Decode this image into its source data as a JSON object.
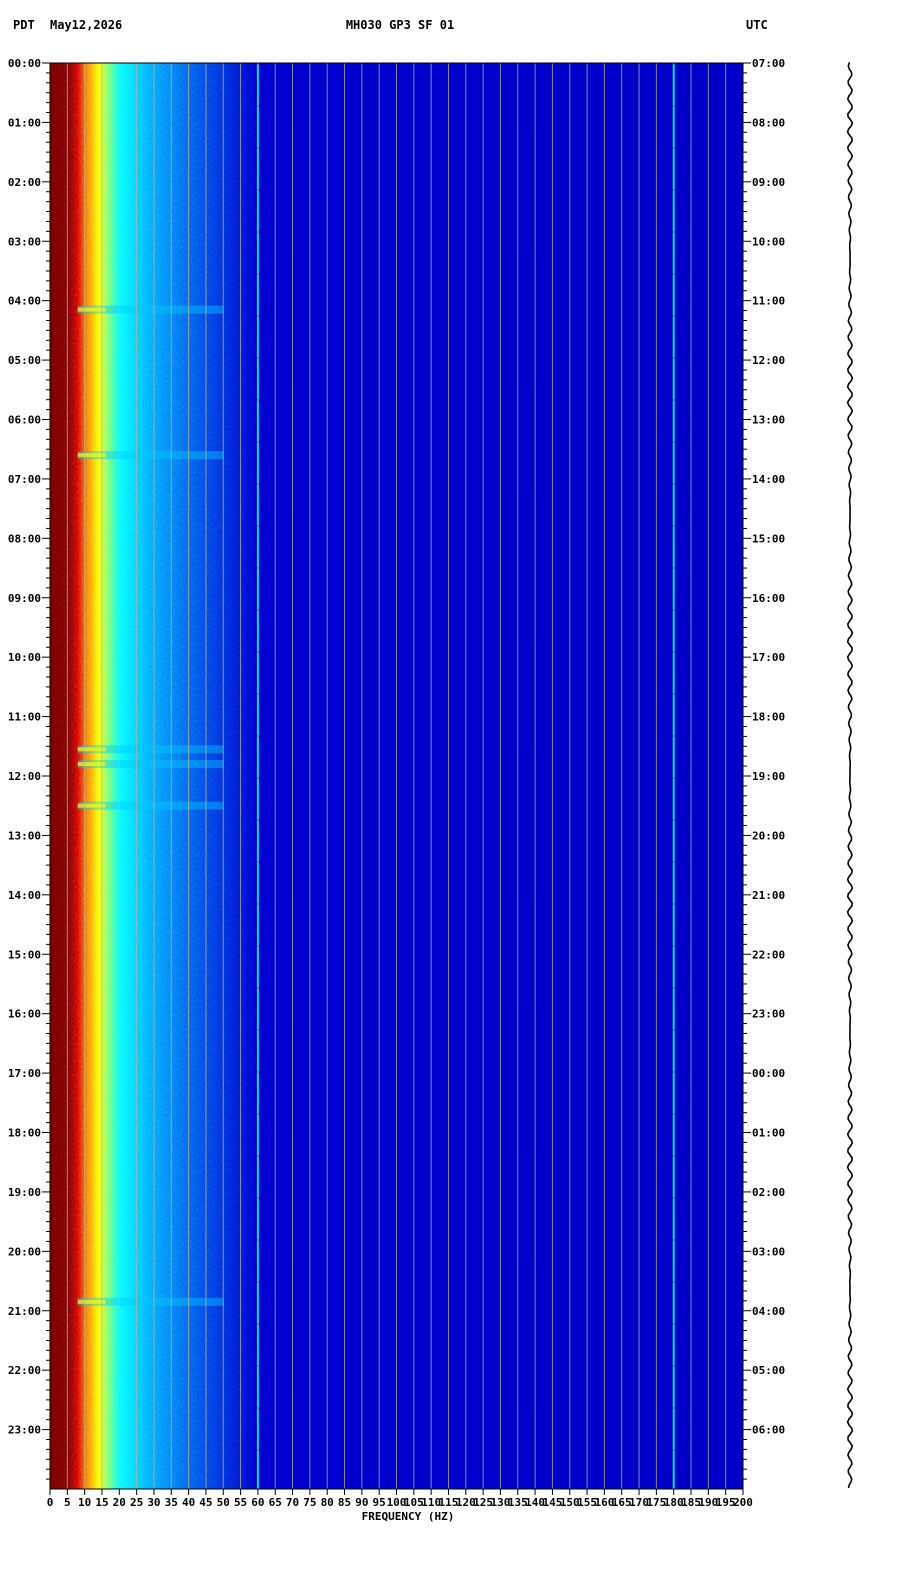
{
  "header": {
    "tz_left": "PDT",
    "date": "May12,2026",
    "station": "MH030 GP3 SF 01",
    "tz_right": "UTC"
  },
  "chart_data": {
    "type": "heatmap",
    "title": "MH030 GP3 SF 01",
    "xlabel": "FREQUENCY (HZ)",
    "xlim": [
      0,
      200
    ],
    "x_ticks": [
      0,
      5,
      10,
      15,
      20,
      25,
      30,
      35,
      40,
      45,
      50,
      55,
      60,
      65,
      70,
      75,
      80,
      85,
      90,
      95,
      100,
      105,
      110,
      115,
      120,
      125,
      130,
      135,
      140,
      145,
      150,
      155,
      160,
      165,
      170,
      175,
      180,
      185,
      190,
      195,
      200
    ],
    "y_left_labels": [
      "00:00",
      "01:00",
      "02:00",
      "03:00",
      "04:00",
      "05:00",
      "06:00",
      "07:00",
      "08:00",
      "09:00",
      "10:00",
      "11:00",
      "12:00",
      "13:00",
      "14:00",
      "15:00",
      "16:00",
      "17:00",
      "18:00",
      "19:00",
      "20:00",
      "21:00",
      "22:00",
      "23:00"
    ],
    "y_right_labels": [
      "07:00",
      "08:00",
      "09:00",
      "10:00",
      "11:00",
      "12:00",
      "13:00",
      "14:00",
      "15:00",
      "16:00",
      "17:00",
      "18:00",
      "19:00",
      "20:00",
      "21:00",
      "22:00",
      "23:00",
      "00:00",
      "01:00",
      "02:00",
      "03:00",
      "04:00",
      "05:00",
      "06:00"
    ],
    "ylim_hours": [
      0,
      24
    ],
    "colormap": [
      "#800000",
      "#e00000",
      "#ff8000",
      "#ffff00",
      "#00ffff",
      "#0080ff",
      "#0000c8"
    ],
    "background_level_color": "#0000c8",
    "narrowband_lines_hz": [
      60,
      180
    ],
    "noise_bursts_hours": [
      4.15,
      6.6,
      11.55,
      11.8,
      12.5,
      20.85
    ]
  }
}
